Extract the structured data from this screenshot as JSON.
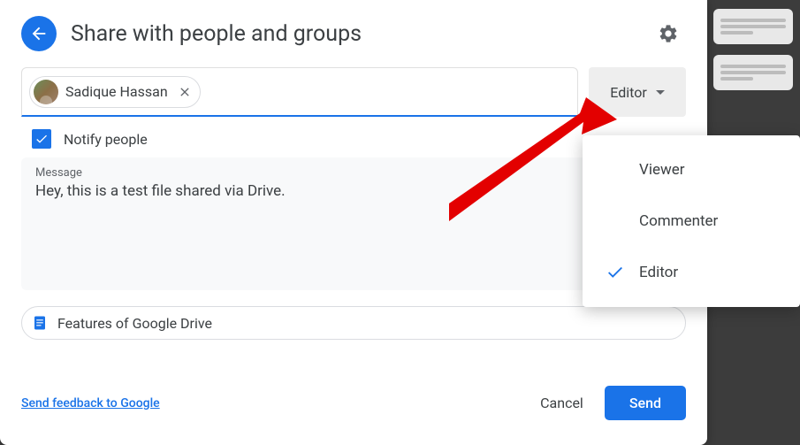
{
  "header": {
    "title": "Share with people and groups"
  },
  "recipient": {
    "name": "Sadique Hassan"
  },
  "role": {
    "selected": "Editor",
    "options": [
      "Viewer",
      "Commenter",
      "Editor"
    ]
  },
  "notify": {
    "label": "Notify people",
    "checked": true
  },
  "message": {
    "label": "Message",
    "text": "Hey, this is a test file shared via Drive."
  },
  "attachment": {
    "name": "Features of Google Drive"
  },
  "footer": {
    "feedback": "Send feedback to Google",
    "cancel": "Cancel",
    "send": "Send"
  }
}
